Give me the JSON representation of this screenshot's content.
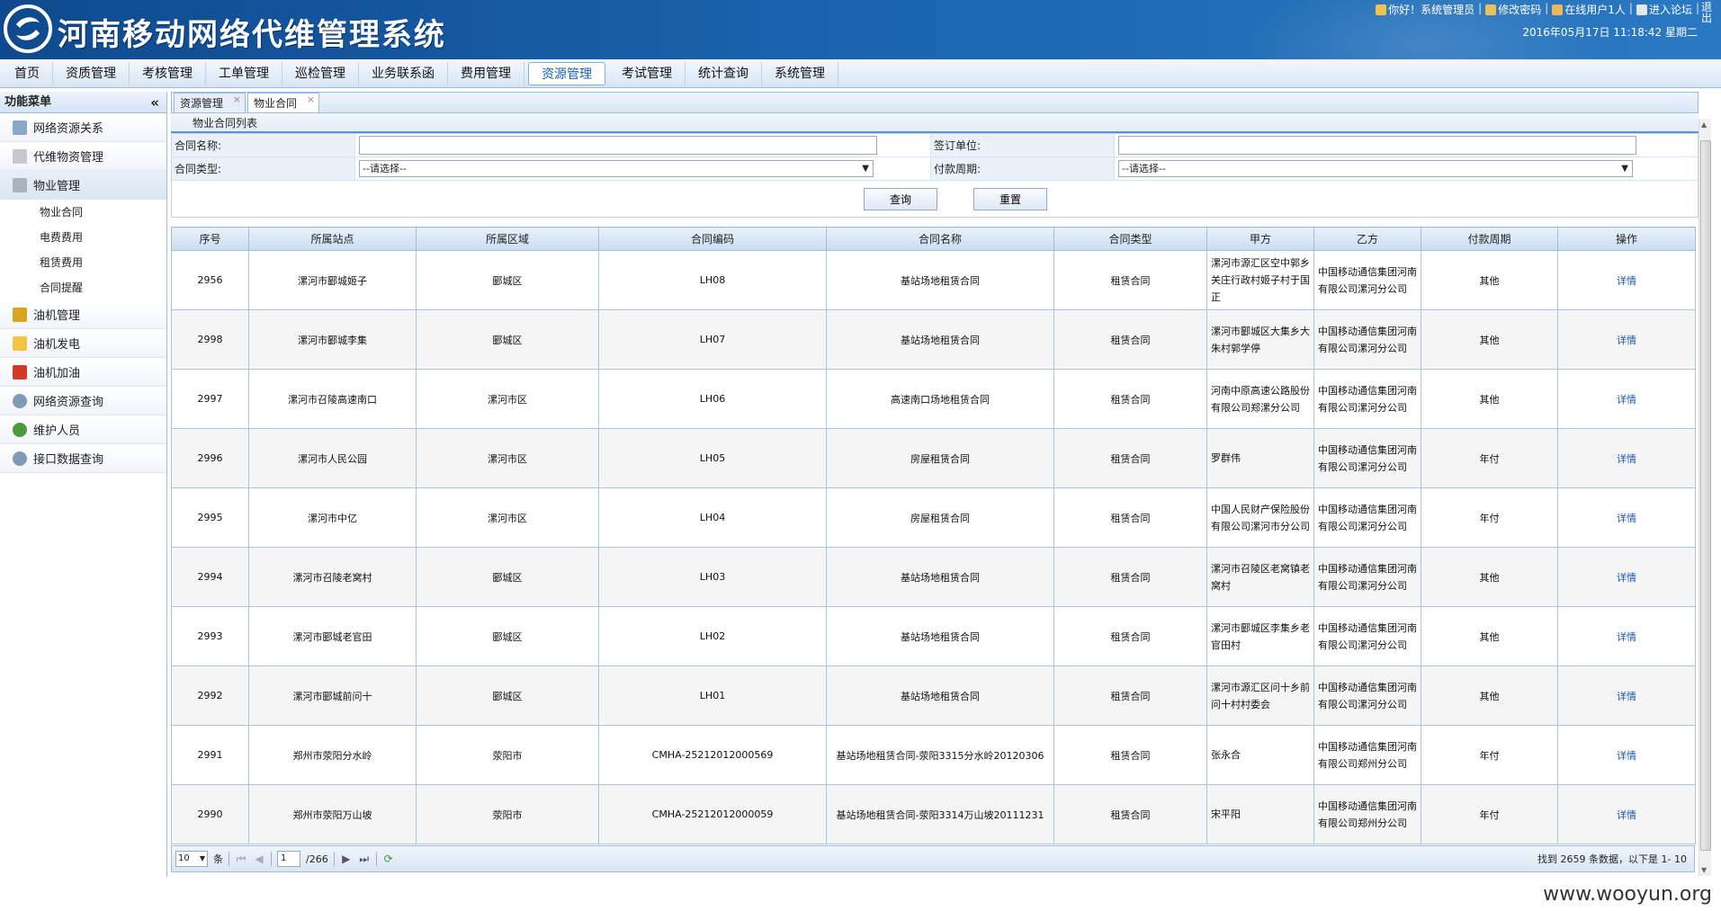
{
  "header": {
    "title": "河南移动网络代维管理系统",
    "greeting": "你好！系统管理员",
    "change_password": "修改密码",
    "online_users": "在线用户1人",
    "forum": "进入论坛",
    "exit": "退出",
    "datetime": "2016年05月17日  11:18:42 星期二"
  },
  "mainnav": [
    "首页",
    "资质管理",
    "考核管理",
    "工单管理",
    "巡检管理",
    "业务联系函",
    "费用管理",
    "资源管理",
    "考试管理",
    "统计查询",
    "系统管理"
  ],
  "sidebar": {
    "title": "功能菜单",
    "collapse": "«",
    "items": [
      {
        "label": "网络资源关系",
        "icon": "network-relation-icon"
      },
      {
        "label": "代维物资管理",
        "icon": "filter-icon"
      },
      {
        "label": "物业管理",
        "icon": "property-icon"
      },
      {
        "label": "油机管理",
        "icon": "radiation-icon"
      },
      {
        "label": "油机发电",
        "icon": "lightning-icon"
      },
      {
        "label": "油机加油",
        "icon": "fuel-icon"
      },
      {
        "label": "网络资源查询",
        "icon": "search-icon"
      },
      {
        "label": "维护人员",
        "icon": "person-icon"
      },
      {
        "label": "接口数据查询",
        "icon": "search-icon"
      }
    ],
    "subitems": [
      "物业合同",
      "电费费用",
      "租赁费用",
      "合同提醒"
    ]
  },
  "tabs": [
    {
      "label": "资源管理",
      "close": "×"
    },
    {
      "label": "物业合同",
      "close": "×"
    }
  ],
  "panel_title": "物业合同列表",
  "search": {
    "contract_name_label": "合同名称:",
    "signing_unit_label": "签订单位:",
    "contract_type_label": "合同类型:",
    "payment_cycle_label": "付款周期:",
    "contract_type_value": "--请选择--",
    "payment_cycle_value": "--请选择--",
    "query_btn": "查询",
    "reset_btn": "重置"
  },
  "table": {
    "headers": [
      "序号",
      "所属站点",
      "所属区域",
      "合同编码",
      "合同名称",
      "合同类型",
      "甲方",
      "乙方",
      "付款周期",
      "操作"
    ],
    "rows": [
      [
        "2956",
        "漯河市郾城姬子",
        "郾城区",
        "LH08",
        "基站场地租赁合同",
        "租赁合同",
        "漯河市源汇区空中郭乡关庄行政村姬子村于国正",
        "中国移动通信集团河南有限公司漯河分公司",
        "其他",
        "详情"
      ],
      [
        "2998",
        "漯河市郾城李集",
        "郾城区",
        "LH07",
        "基站场地租赁合同",
        "租赁合同",
        "漯河市郾城区大集乡大朱村郭学停",
        "中国移动通信集团河南有限公司漯河分公司",
        "其他",
        "详情"
      ],
      [
        "2997",
        "漯河市召陵高速南口",
        "漯河市区",
        "LH06",
        "高速南口场地租赁合同",
        "租赁合同",
        "河南中原高速公路股份有限公司郑漯分公司",
        "中国移动通信集团河南有限公司漯河分公司",
        "其他",
        "详情"
      ],
      [
        "2996",
        "漯河市人民公园",
        "漯河市区",
        "LH05",
        "房屋租赁合同",
        "租赁合同",
        "罗群伟",
        "中国移动通信集团河南有限公司漯河分公司",
        "年付",
        "详情"
      ],
      [
        "2995",
        "漯河市中亿",
        "漯河市区",
        "LH04",
        "房屋租赁合同",
        "租赁合同",
        "中国人民财产保险股份有限公司漯河市分公司",
        "中国移动通信集团河南有限公司漯河分公司",
        "年付",
        "详情"
      ],
      [
        "2994",
        "漯河市召陵老窝村",
        "郾城区",
        "LH03",
        "基站场地租赁合同",
        "租赁合同",
        "漯河市召陵区老窝镇老窝村",
        "中国移动通信集团河南有限公司漯河分公司",
        "其他",
        "详情"
      ],
      [
        "2993",
        "漯河市郾城老官田",
        "郾城区",
        "LH02",
        "基站场地租赁合同",
        "租赁合同",
        "漯河市郾城区李集乡老官田村",
        "中国移动通信集团河南有限公司漯河分公司",
        "其他",
        "详情"
      ],
      [
        "2992",
        "漯河市郾城前问十",
        "郾城区",
        "LH01",
        "基站场地租赁合同",
        "租赁合同",
        "漯河市源汇区问十乡前问十村村委会",
        "中国移动通信集团河南有限公司漯河分公司",
        "其他",
        "详情"
      ],
      [
        "2991",
        "郑州市荥阳分水岭",
        "荥阳市",
        "CMHA-25212012000569",
        "基站场地租赁合同-荥阳3315分水岭20120306",
        "租赁合同",
        "张永合",
        "中国移动通信集团河南有限公司郑州分公司",
        "年付",
        "详情"
      ],
      [
        "2990",
        "郑州市荥阳万山坡",
        "荥阳市",
        "CMHA-25212012000059",
        "基站场地租赁合同-荥阳3314万山坡20111231",
        "租赁合同",
        "宋平阳",
        "中国移动通信集团河南有限公司郑州分公司",
        "年付",
        "详情"
      ]
    ]
  },
  "pager": {
    "page_size": "10",
    "page_size_unit": "条",
    "current_page": "1",
    "total_pages": "/266",
    "info": "找到 2659 条数据，以下是 1- 10"
  },
  "watermark": "www.wooyun.org",
  "colors": {
    "header_blue": "#1a62ac",
    "link_blue": "#1a55b0",
    "border_blue": "#9fbddf"
  }
}
